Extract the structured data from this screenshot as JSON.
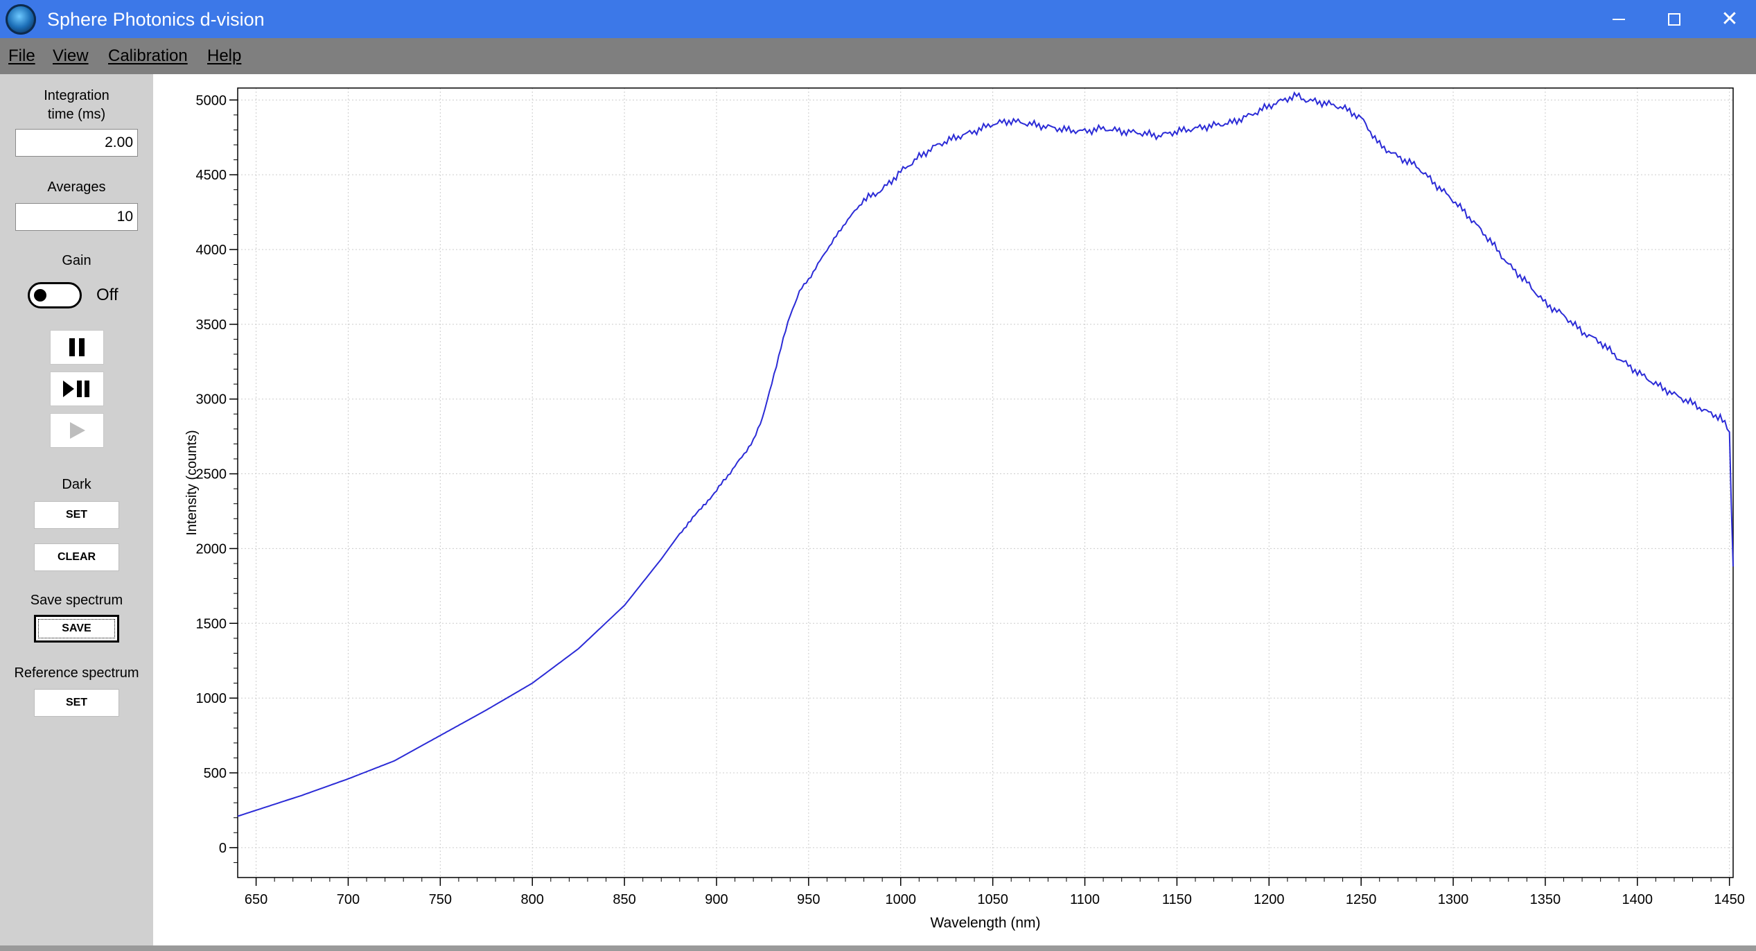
{
  "window": {
    "title": "Sphere Photonics d-vision",
    "icon": "sphere-logo-icon",
    "controls": [
      "minimize-icon",
      "maximize-icon",
      "close-icon"
    ]
  },
  "menu": {
    "items": [
      {
        "label": "File"
      },
      {
        "label": "View"
      },
      {
        "label": "Calibration"
      },
      {
        "label": "Help"
      }
    ]
  },
  "panel": {
    "integration_label_line1": "Integration",
    "integration_label_line2": "time (ms)",
    "integration_value": "2.00",
    "averages_label": "Averages",
    "averages_value": "10",
    "gain_label": "Gain",
    "gain_state": "Off",
    "pause_icon": "pause-icon",
    "step_icon": "step-play-pause-icon",
    "play_icon": "play-icon",
    "dark_label": "Dark",
    "dark_set": "SET",
    "dark_clear": "CLEAR",
    "save_label": "Save spectrum",
    "save_button": "SAVE",
    "reference_label": "Reference spectrum",
    "reference_set": "SET"
  },
  "colors": {
    "titlebar": "#3c78e8",
    "menubar": "#7f7f7f",
    "panel": "#d0d0d0",
    "series": "#2b2bd6",
    "grid": "#cccccc"
  },
  "chart_data": {
    "type": "line",
    "xlabel": "Wavelength (nm)",
    "ylabel": "Intensity (counts)",
    "xlim": [
      640,
      1452
    ],
    "ylim": [
      -200,
      5080
    ],
    "xticks": [
      650,
      700,
      750,
      800,
      850,
      900,
      950,
      1000,
      1050,
      1100,
      1150,
      1200,
      1250,
      1300,
      1350,
      1400,
      1450
    ],
    "yticks": [
      0,
      500,
      1000,
      1500,
      2000,
      2500,
      3000,
      3500,
      4000,
      4500,
      5000
    ],
    "grid": true,
    "series": [
      {
        "color": "#2b2bd6",
        "x": [
          640,
          650,
          675,
          700,
          725,
          750,
          775,
          800,
          825,
          850,
          870,
          880,
          900,
          910,
          920,
          925,
          930,
          935,
          940,
          945,
          950,
          960,
          970,
          980,
          990,
          1000,
          1010,
          1020,
          1030,
          1040,
          1050,
          1060,
          1070,
          1080,
          1090,
          1100,
          1110,
          1120,
          1130,
          1140,
          1150,
          1160,
          1170,
          1180,
          1190,
          1200,
          1210,
          1215,
          1220,
          1230,
          1240,
          1250,
          1260,
          1270,
          1280,
          1290,
          1300,
          1310,
          1320,
          1330,
          1340,
          1350,
          1360,
          1370,
          1380,
          1390,
          1400,
          1410,
          1420,
          1430,
          1440,
          1445,
          1450,
          1451,
          1452
        ],
        "y": [
          210,
          250,
          350,
          460,
          580,
          750,
          920,
          1100,
          1330,
          1620,
          1930,
          2100,
          2390,
          2550,
          2720,
          2880,
          3100,
          3350,
          3560,
          3720,
          3800,
          4000,
          4180,
          4330,
          4400,
          4520,
          4620,
          4700,
          4750,
          4790,
          4840,
          4860,
          4840,
          4820,
          4800,
          4790,
          4810,
          4790,
          4780,
          4760,
          4790,
          4810,
          4830,
          4850,
          4900,
          4960,
          5010,
          5030,
          5000,
          4980,
          4950,
          4880,
          4700,
          4620,
          4560,
          4440,
          4330,
          4200,
          4060,
          3900,
          3780,
          3640,
          3560,
          3450,
          3380,
          3270,
          3180,
          3100,
          3030,
          2970,
          2900,
          2880,
          2780,
          2300,
          1880
        ]
      }
    ]
  }
}
